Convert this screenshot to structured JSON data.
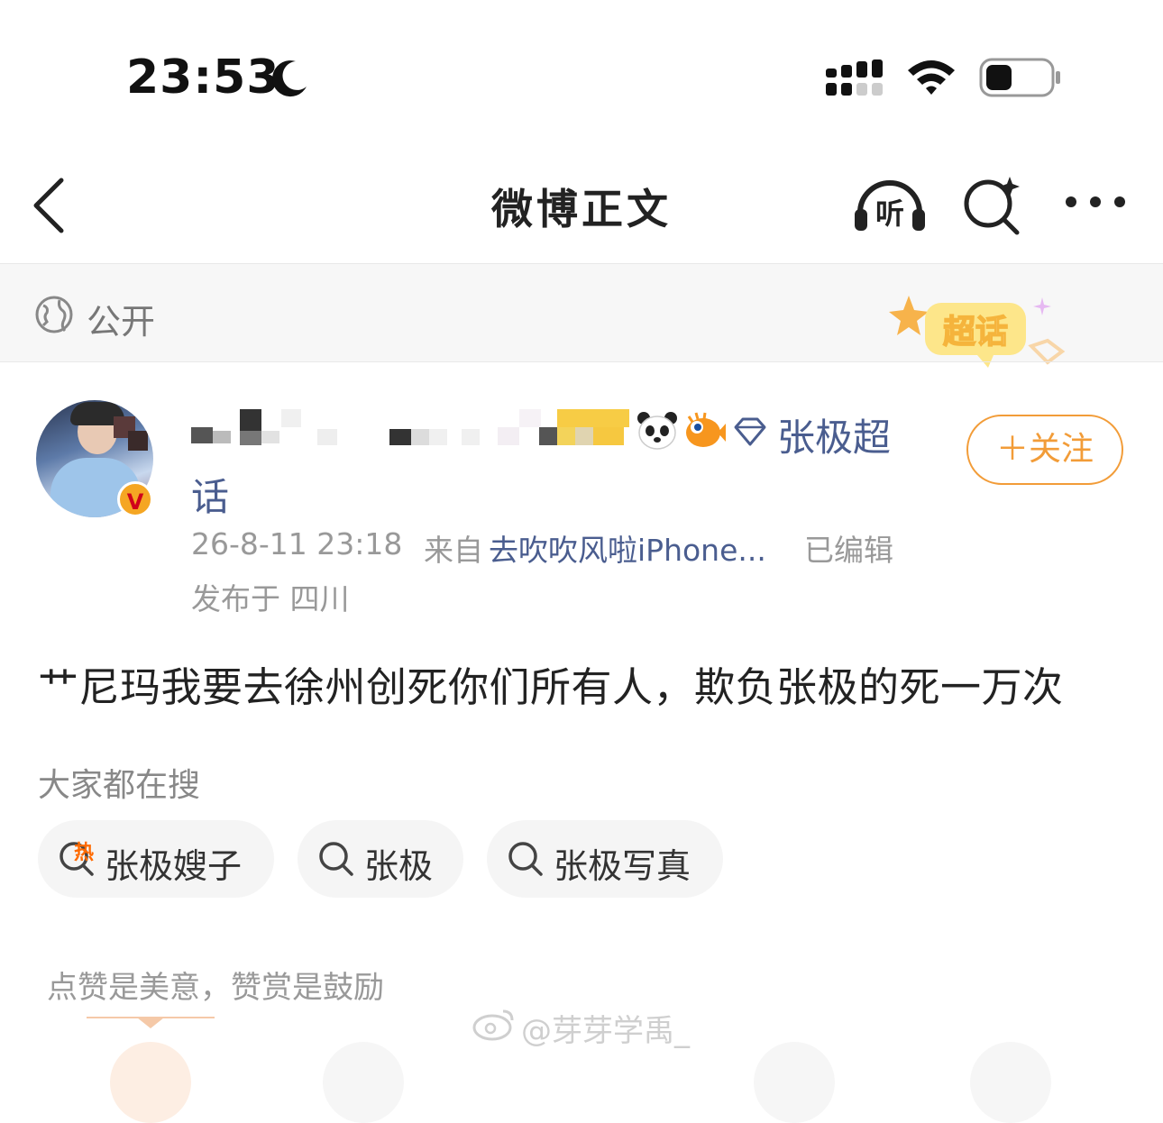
{
  "status_bar": {
    "time": "23:53"
  },
  "nav": {
    "title": "微博正文",
    "listen_label": "听"
  },
  "visibility": {
    "label": "公开",
    "supertopic_badge": "超话"
  },
  "author": {
    "supertopic_link_part1": "张极超",
    "supertopic_link_part2": "话",
    "verified_badge": "V",
    "follow_button": "＋关注"
  },
  "meta": {
    "time": "26-8-11 23:18",
    "from_label": "来自",
    "client": "去吹吹风啦iPhone...",
    "edited": "已编辑",
    "location": "发布于 四川"
  },
  "post": {
    "text": "艹尼玛我要去徐州创死你们所有人，欺负张极的死一万次"
  },
  "searches": {
    "heading": "大家都在搜",
    "hot_mark": "热",
    "items": [
      "张极嫂子",
      "张极",
      "张极写真"
    ]
  },
  "reward": {
    "text": "点赞是美意，赞赏是鼓励"
  },
  "watermark": {
    "text": "@芽芽学禹_"
  },
  "colors": {
    "link": "#4a5d8f",
    "follow": "#f29c38",
    "hot": "#ff6a00"
  }
}
